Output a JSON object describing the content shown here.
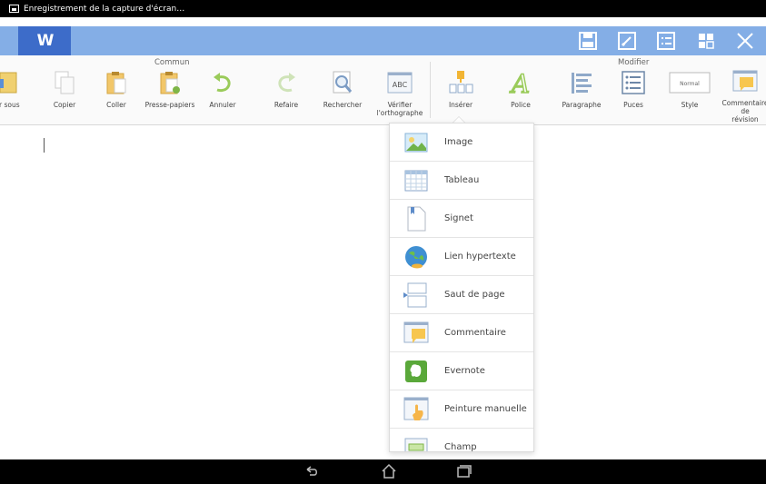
{
  "status_bar": {
    "notification": "Enregistrement de la capture d'écran…",
    "icon": "screenshot-icon"
  },
  "app": {
    "logo_text": "W",
    "title_bar_color": "#84aee6",
    "logo_color": "#3d6cc9",
    "toolbar_icons": [
      "save-icon",
      "edit-icon",
      "list-view-icon",
      "grid-icon",
      "close-icon"
    ]
  },
  "ribbon": {
    "groups": {
      "commun": "Commun",
      "modifier": "Modifier"
    },
    "items": [
      {
        "label": "er sous",
        "icon": "save-as-icon"
      },
      {
        "label": "Copier",
        "icon": "copy-icon"
      },
      {
        "label": "Coller",
        "icon": "paste-icon"
      },
      {
        "label": "Presse-papiers",
        "icon": "clipboard-icon"
      },
      {
        "label": "Annuler",
        "icon": "undo-icon"
      },
      {
        "label": "Refaire",
        "icon": "redo-icon"
      },
      {
        "label": "Rechercher",
        "icon": "search-icon"
      },
      {
        "label": "Vérifier\nl'orthographe",
        "icon": "spellcheck-icon",
        "icon_text": "ABC"
      },
      {
        "label": "Insérer",
        "icon": "insert-icon"
      },
      {
        "label": "Police",
        "icon": "font-icon",
        "icon_text": "A"
      },
      {
        "label": "Paragraphe",
        "icon": "paragraph-icon"
      },
      {
        "label": "Puces",
        "icon": "bullets-icon"
      },
      {
        "label": "Style",
        "icon": "style-icon",
        "icon_text": "Normal"
      },
      {
        "label": "Commentaire de\nrévision",
        "icon": "comment-icon"
      }
    ]
  },
  "insert_menu": {
    "items": [
      {
        "label": "Image",
        "icon": "image-icon"
      },
      {
        "label": "Tableau",
        "icon": "table-icon"
      },
      {
        "label": "Signet",
        "icon": "bookmark-icon"
      },
      {
        "label": "Lien hypertexte",
        "icon": "hyperlink-icon"
      },
      {
        "label": "Saut de page",
        "icon": "page-break-icon"
      },
      {
        "label": "Commentaire",
        "icon": "comment-icon"
      },
      {
        "label": "Evernote",
        "icon": "evernote-icon"
      },
      {
        "label": "Peinture manuelle",
        "icon": "hand-paint-icon"
      },
      {
        "label": "Champ",
        "icon": "field-icon"
      }
    ]
  },
  "nav_bar": {
    "buttons": [
      "back-icon",
      "home-icon",
      "recent-apps-icon"
    ]
  }
}
